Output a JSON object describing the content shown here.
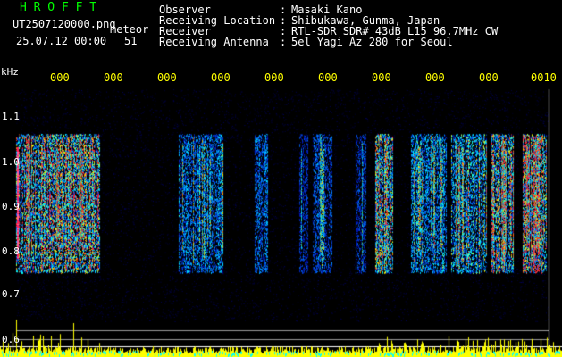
{
  "header": {
    "app_name": "H R O F F T",
    "filename": "UT2507120000.png",
    "meteor_label": "meteor",
    "date_time": "25.07.12 00:00",
    "count": "51",
    "fields": [
      {
        "label": "Observer",
        "sep": ":",
        "value": "Masaki Kano"
      },
      {
        "label": "Receiving Location",
        "sep": ":",
        "value": "Shibukawa, Gunma, Japan"
      },
      {
        "label": "Receiver",
        "sep": ":",
        "value": "RTL-SDR SDR# 43dB L15 96.7MHz CW"
      },
      {
        "label": "Receiving Antenna",
        "sep": ":",
        "value": "5el Yagi Az 280 for Seoul"
      }
    ]
  },
  "spectrogram": {
    "y_unit": "kHz",
    "y_ticks": [
      "1.1",
      "1.0",
      "0.9",
      "0.8",
      "0.7",
      "0.6"
    ],
    "time_ticks": [
      "000",
      "000",
      "000",
      "000",
      "000",
      "000",
      "000",
      "000",
      "000",
      "0010"
    ],
    "colors": {
      "background": "#000000",
      "axis_text": "#ffffff",
      "time_text": "#ffff00",
      "app_name": "#00ff00",
      "meteor_bars": "#ffff00",
      "noise_bars": "#00ffff"
    }
  }
}
